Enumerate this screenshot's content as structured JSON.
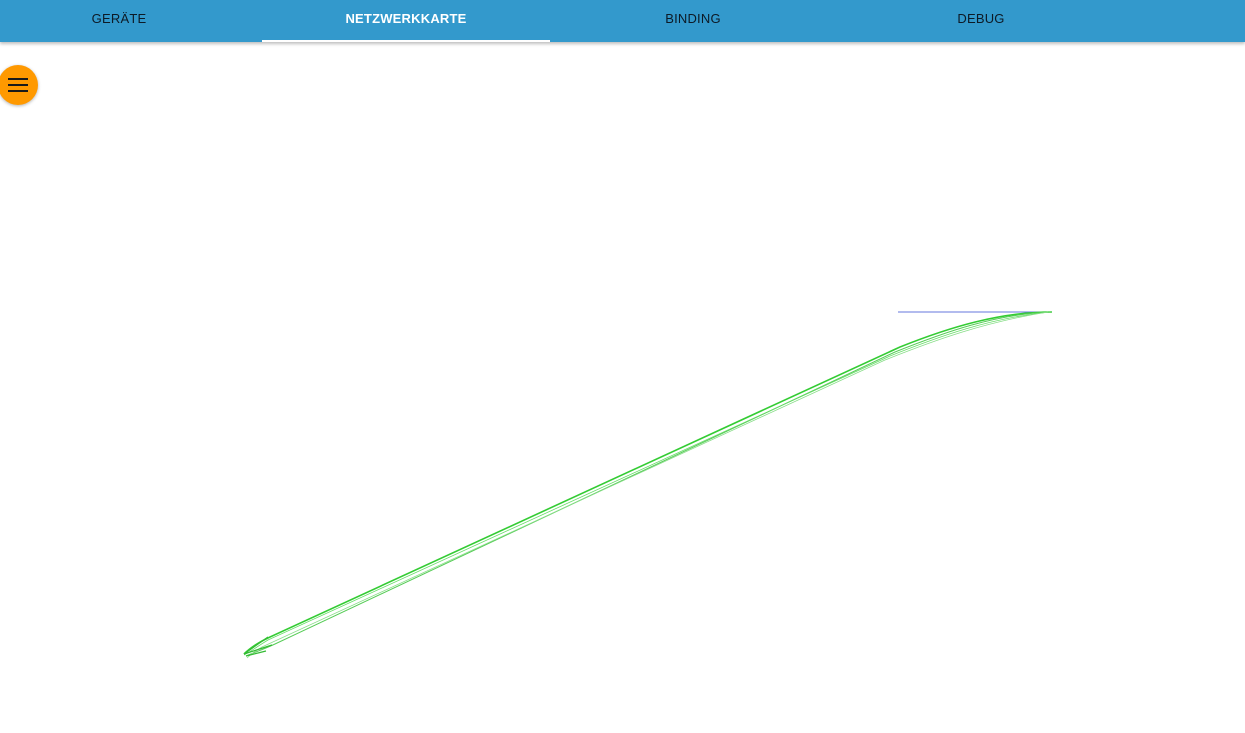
{
  "tabs": [
    {
      "label": "Geräte",
      "active": false
    },
    {
      "label": "Netzwerkkarte",
      "active": true
    },
    {
      "label": "Binding",
      "active": false
    },
    {
      "label": "Debug",
      "active": false
    }
  ],
  "menu_button": {
    "icon": "hamburger-menu-icon",
    "color": "#ff9900"
  },
  "colors": {
    "tabbar": "#3399cc",
    "active_tab_text": "#ffffff",
    "link_green": "#33cc33",
    "link_blue": "#6677dd"
  }
}
